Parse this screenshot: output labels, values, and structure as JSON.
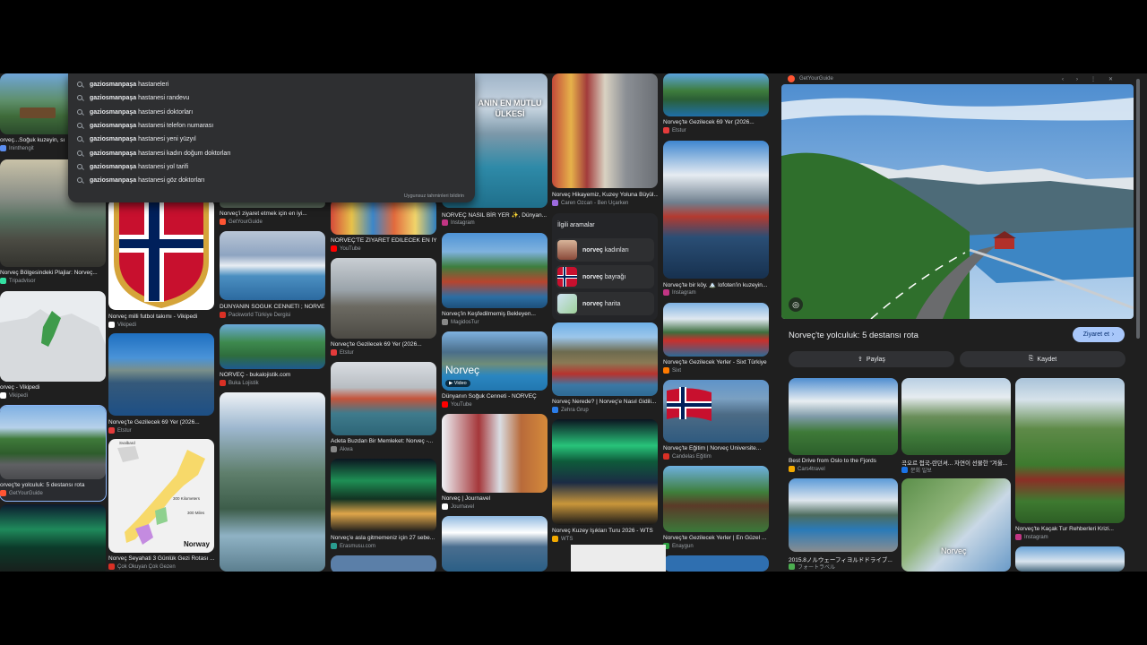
{
  "suggestions": {
    "query_prefix": "gaziosmanpaşa",
    "items": [
      {
        "bold": "gaziosmanpaşa",
        "rest": " hastaneleri"
      },
      {
        "bold": "gaziosmanpaşa",
        "rest": " hastanesi randevu"
      },
      {
        "bold": "gaziosmanpaşa",
        "rest": " hastanesi doktorları"
      },
      {
        "bold": "gaziosmanpaşa",
        "rest": " hastanesi telefon numarası"
      },
      {
        "bold": "gaziosmanpaşa",
        "rest": " hastanesi yeni yüzyıl"
      },
      {
        "bold": "gaziosmanpaşa",
        "rest": " hastanesi kadın doğum doktorları"
      },
      {
        "bold": "gaziosmanpaşa",
        "rest": " hastanesi yol tarifi"
      },
      {
        "bold": "gaziosmanpaşa",
        "rest": " hastanesi göz doktorları"
      }
    ],
    "report_label": "Uygunsuz tahminleri bildirin"
  },
  "grid": {
    "col1": [
      {
        "caption": "orveç...Soğuk kuzeyin, sı",
        "source": "Ininthengit"
      },
      {
        "caption": "Norveç Bölgesindeki Plajlar: Norveç...",
        "source": "Tripadvisor"
      },
      {
        "caption": "orveç - Vikipedi",
        "source": "Vikipedi"
      },
      {
        "caption": "orveç'te yolculuk: 5 destansı rota",
        "source": "GetYourGuide"
      }
    ],
    "col2": [
      {
        "caption": "Norveç milli futbol takımı - Vikipedi",
        "source": "Vikipedi"
      },
      {
        "caption": "Norveç'te Gezilecek 69 Yer (2026...",
        "source": "Etstur"
      },
      {
        "caption": "Norveç Seyahati 3 Günlük Gezi Rotası ...",
        "source": "Çok Okuyan Çok Gezen"
      }
    ],
    "col3": [
      {
        "caption": "Norveç'i ziyaret etmek için en iyi...",
        "source": "GetYourGuide"
      },
      {
        "caption": "DÜNYANIN SOĞUK CENNETİ ; NORVE...",
        "source": "Packworld Türkiye Dergisi"
      },
      {
        "caption": "NORVEÇ - bukalojistik.com",
        "source": "Buka Lojistik"
      }
    ],
    "col4": [
      {
        "caption": "NORVEÇ'TE ZİYARET EDİLECEK EN İYİ...",
        "source": "YouTube"
      },
      {
        "caption": "Norveç'te Gezilecek 69 Yer (2026...",
        "source": "Etstur"
      },
      {
        "caption": "Adeta Buzdan Bir Memleket: Norveç -...",
        "source": "Akwa"
      },
      {
        "caption": "Norveç'e asla gitmemeniz için 27 sebe...",
        "source": "Erasmusu.com"
      }
    ],
    "col5": [
      {
        "caption": "NORVEÇ NASIL BİR YER ✨, Dünyan...",
        "source": "Instagram",
        "overlay": "ANIN EN MUTLU ÜLKESİ"
      },
      {
        "caption": "Norveç'in Keşfedilmemiş Bekleyen...",
        "source": "MagidosTur"
      },
      {
        "caption": "Dünyanın Soğuk Cenneti - NORVEÇ",
        "source": "YouTube",
        "overlay": "Norveç",
        "badge": "Video"
      },
      {
        "caption": "Norveç | Journavel",
        "source": "Journavel"
      }
    ],
    "col6": [
      {
        "caption": "Norveç Hikayemiz, Kuzey Yoluna Büyül...",
        "source": "Caren Özcan - Ben Uçarken"
      },
      {
        "caption": "Norveç Nerede? | Norveç'e Nasıl Gidili...",
        "source": "Zehra Grup"
      },
      {
        "caption": "Norveç Kuzey Işıkları Turu 2026 - WTS",
        "source": "WTS"
      }
    ],
    "col7": [
      {
        "caption": "Norveç'te Gezilecek 69 Yer (2026...",
        "source": "Etstur"
      },
      {
        "caption": "Norveç'te bir köy. 🏔️ lofoten'in kuzeyin...",
        "source": "Instagram"
      },
      {
        "caption": "Norveç'te Gezilecek Yerler - Sixt Türkiye",
        "source": "Sixt"
      },
      {
        "caption": "Norveç'te Eğitim | Norveç Üniversite...",
        "source": "Candelas Eğitim"
      },
      {
        "caption": "Norveç'te Gezilecek Yerler | En Güzel ...",
        "source": "Enaygun"
      }
    ]
  },
  "related": {
    "title": "İlgili aramalar",
    "items": [
      {
        "bold": "norveç",
        "rest": " kadınları"
      },
      {
        "bold": "norveç",
        "rest": " bayrağı"
      },
      {
        "bold": "norveç",
        "rest": " harita"
      }
    ]
  },
  "map_labels": {
    "svalbard": "Svalbard",
    "km": "300 Kilometers",
    "miles": "300 Miles",
    "norway": "Norway"
  },
  "panel": {
    "site_name": "GetYourGuide",
    "title": "Norveç'te yolculuk: 5 destansı rota",
    "visit_label": "Ziyaret et",
    "share_label": "Paylaş",
    "save_label": "Kaydet",
    "related_cards": [
      {
        "caption": "Best Drive from Oslo to the Fjords",
        "source": "Cars4travel"
      },
      {
        "caption": "곡오르 접국-란던셔... 자연이 선물한 \"겨울...",
        "source": "문회 일보"
      },
      {
        "caption": "Norveç'te Kaçak Tur Rehberleri Krizi...",
        "source": "Instagram"
      },
      {
        "caption": "2015.8ノルウェーフィヨルドドライブ...",
        "source": "フォートラベル"
      },
      {
        "caption": "",
        "source": "",
        "overlay": "Norveç"
      },
      {
        "caption": "",
        "source": ""
      }
    ]
  },
  "colors": {
    "background": "#1f1f1f",
    "surface": "#2e2f31",
    "accent": "#a8c7fa",
    "text": "#e8eaed",
    "muted": "#9aa0a6"
  }
}
